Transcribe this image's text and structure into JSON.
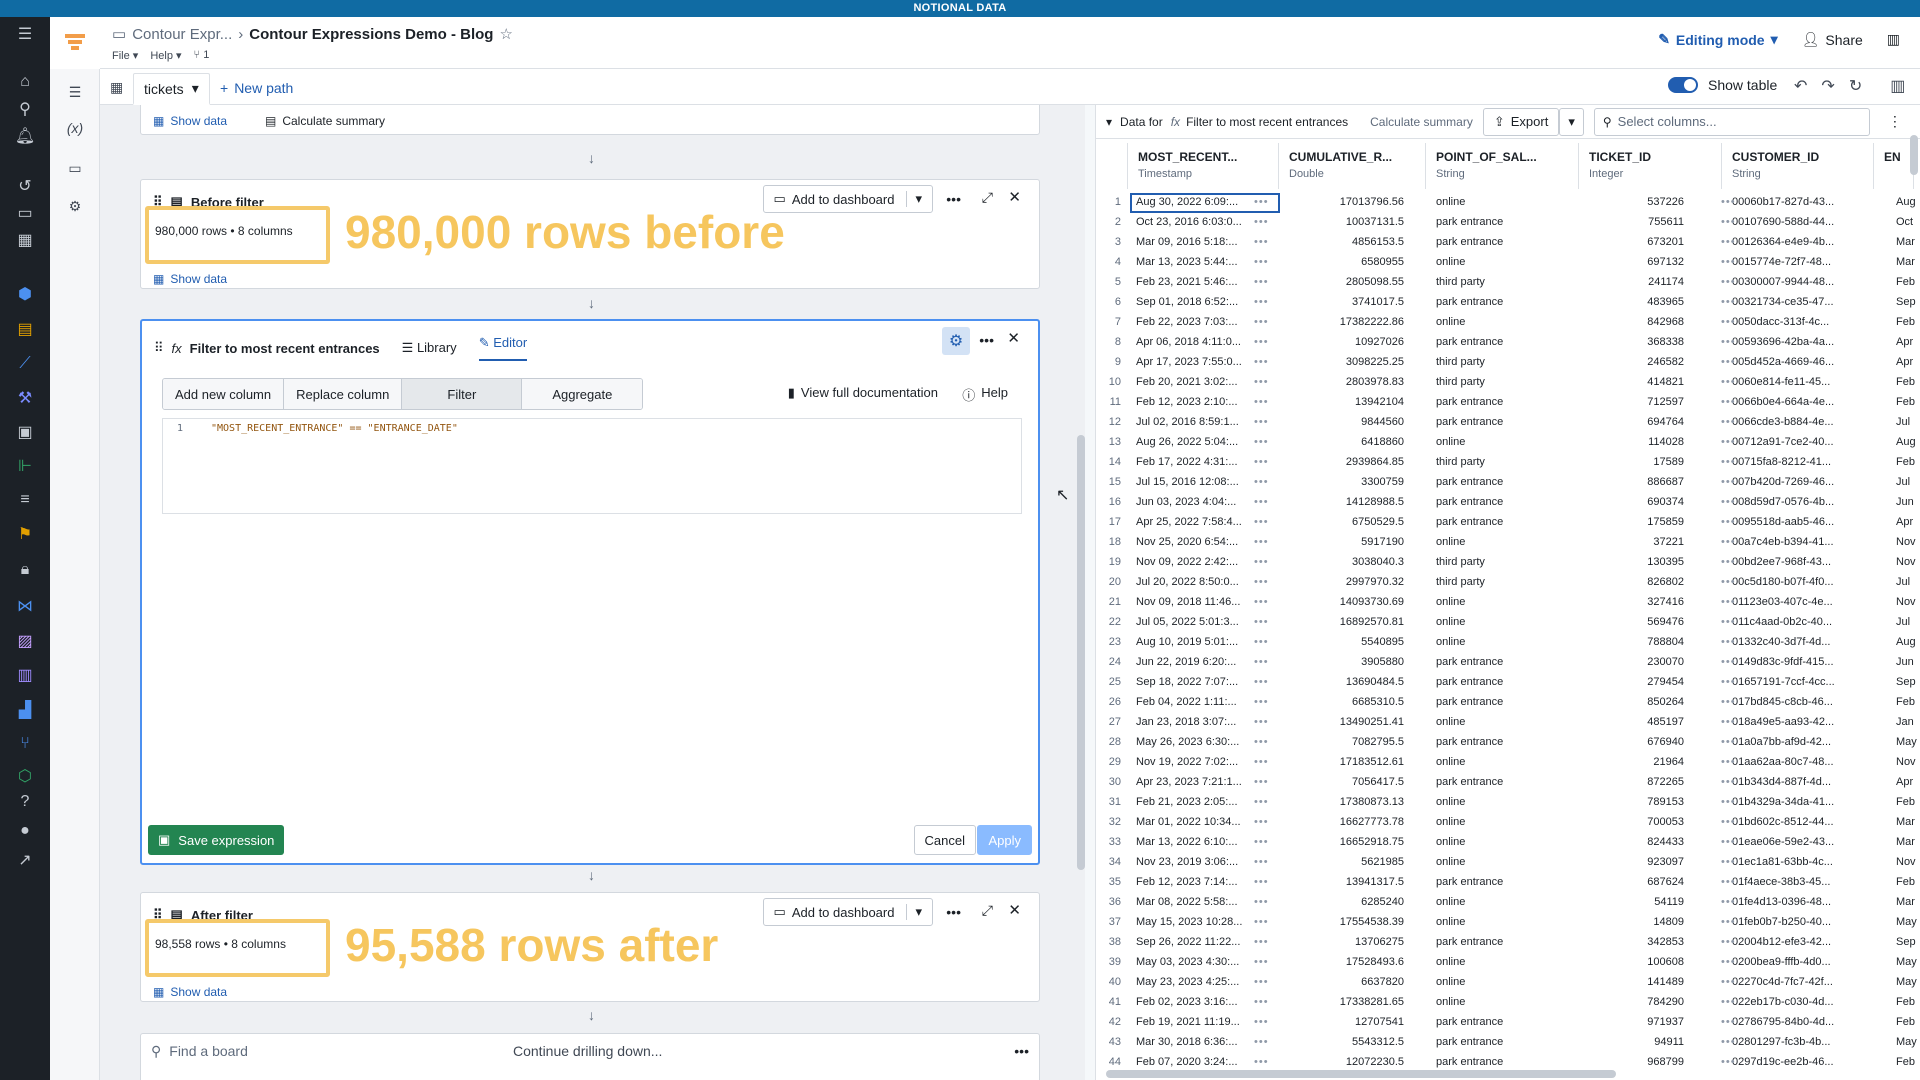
{
  "banner": "NOTIONAL DATA",
  "header": {
    "breadcrumb_parent": "Contour Expr...",
    "title": "Contour Expressions Demo - Blog",
    "menu_file": "File",
    "menu_help": "Help",
    "branch_count": "1",
    "editing_mode": "Editing mode",
    "share": "Share"
  },
  "tabs": {
    "active": "tickets",
    "new_path": "New path"
  },
  "board_top": {
    "show_data": "Show data",
    "calc_summary": "Calculate summary"
  },
  "before": {
    "title": "Before filter",
    "rows": "980,000 rows",
    "cols": "8 columns",
    "add_dash": "Add to dashboard",
    "show_data": "Show data",
    "annotation": "980,000 rows before"
  },
  "filter": {
    "title": "Filter to most recent entrances",
    "library": "Library",
    "editor": "Editor",
    "seg": [
      "Add new column",
      "Replace column",
      "Filter",
      "Aggregate"
    ],
    "docs": "View full documentation",
    "help": "Help",
    "line_no": "1",
    "code": "\"MOST_RECENT_ENTRANCE\" == \"ENTRANCE_DATE\"",
    "save": "Save expression",
    "cancel": "Cancel",
    "apply": "Apply"
  },
  "after": {
    "title": "After filter",
    "rows": "98,558 rows",
    "cols": "8 columns",
    "add_dash": "Add to dashboard",
    "show_data": "Show data",
    "annotation": "95,588 rows after"
  },
  "bottom": {
    "find": "Find a board",
    "continue": "Continue drilling down..."
  },
  "grid": {
    "show_table": "Show table",
    "data_for": "Data for",
    "board": "Filter to most recent entrances",
    "calc": "Calculate summary",
    "export": "Export",
    "select_placeholder": "Select columns...",
    "columns": [
      {
        "name": "MOST_RECENT...",
        "type": "Timestamp"
      },
      {
        "name": "CUMULATIVE_R...",
        "type": "Double"
      },
      {
        "name": "POINT_OF_SAL...",
        "type": "String"
      },
      {
        "name": "TICKET_ID",
        "type": "Integer"
      },
      {
        "name": "CUSTOMER_ID",
        "type": "String"
      },
      {
        "name": "EN",
        "type": ""
      }
    ],
    "rows": [
      [
        "1",
        "Aug 30, 2022 6:09:...",
        "17013796.56",
        "online",
        "537226",
        "00060b17-827d-43...",
        "Aug"
      ],
      [
        "2",
        "Oct 23, 2016 6:03:0...",
        "10037131.5",
        "park entrance",
        "755611",
        "00107690-588d-44...",
        "Oct"
      ],
      [
        "3",
        "Mar 09, 2016 5:18:...",
        "4856153.5",
        "park entrance",
        "673201",
        "00126364-e4e9-4b...",
        "Mar"
      ],
      [
        "4",
        "Mar 13, 2023 5:44:...",
        "6580955",
        "online",
        "697132",
        "0015774e-72f7-48...",
        "Mar"
      ],
      [
        "5",
        "Feb 23, 2021 5:46:...",
        "2805098.55",
        "third party",
        "241174",
        "00300007-9944-48...",
        "Feb"
      ],
      [
        "6",
        "Sep 01, 2018 6:52:...",
        "3741017.5",
        "park entrance",
        "483965",
        "00321734-ce35-47...",
        "Sep"
      ],
      [
        "7",
        "Feb 22, 2023 7:03:...",
        "17382222.86",
        "online",
        "842968",
        "0050dacc-313f-4c...",
        "Feb"
      ],
      [
        "8",
        "Apr 06, 2018 4:11:0...",
        "10927026",
        "park entrance",
        "368338",
        "00593696-42ba-4a...",
        "Apr"
      ],
      [
        "9",
        "Apr 17, 2023 7:55:0...",
        "3098225.25",
        "third party",
        "246582",
        "005d452a-4669-46...",
        "Apr"
      ],
      [
        "10",
        "Feb 20, 2021 3:02:...",
        "2803978.83",
        "third party",
        "414821",
        "0060e814-fe11-45...",
        "Feb"
      ],
      [
        "11",
        "Feb 12, 2023 2:10:...",
        "13942104",
        "park entrance",
        "712597",
        "0066b0e4-664a-4e...",
        "Feb"
      ],
      [
        "12",
        "Jul 02, 2016 8:59:1...",
        "9844560",
        "park entrance",
        "694764",
        "0066cde3-b884-4e...",
        "Jul"
      ],
      [
        "13",
        "Aug 26, 2022 5:04:...",
        "6418860",
        "online",
        "114028",
        "00712a91-7ce2-40...",
        "Aug"
      ],
      [
        "14",
        "Feb 17, 2022 4:31:...",
        "2939864.85",
        "third party",
        "17589",
        "00715fa8-8212-41...",
        "Feb"
      ],
      [
        "15",
        "Jul 15, 2016 12:08:...",
        "3300759",
        "park entrance",
        "886687",
        "007b420d-7269-46...",
        "Jul"
      ],
      [
        "16",
        "Jun 03, 2023 4:04:...",
        "14128988.5",
        "park entrance",
        "690374",
        "008d59d7-0576-4b...",
        "Jun"
      ],
      [
        "17",
        "Apr 25, 2022 7:58:4...",
        "6750529.5",
        "park entrance",
        "175859",
        "0095518d-aab5-46...",
        "Apr"
      ],
      [
        "18",
        "Nov 25, 2020 6:54:...",
        "5917190",
        "online",
        "37221",
        "00a7c4eb-b394-41...",
        "Nov"
      ],
      [
        "19",
        "Nov 09, 2022 2:42:...",
        "3038040.3",
        "third party",
        "130395",
        "00bd2ee7-968f-43...",
        "Nov"
      ],
      [
        "20",
        "Jul 20, 2022 8:50:0...",
        "2997970.32",
        "third party",
        "826802",
        "00c5d180-b07f-4f0...",
        "Jul"
      ],
      [
        "21",
        "Nov 09, 2018 11:46...",
        "14093730.69",
        "online",
        "327416",
        "01123e03-407c-4e...",
        "Nov"
      ],
      [
        "22",
        "Jul 05, 2022 5:01:3...",
        "16892570.81",
        "online",
        "569476",
        "011c4aad-0b2c-40...",
        "Jul"
      ],
      [
        "23",
        "Aug 10, 2019 5:01:...",
        "5540895",
        "online",
        "788804",
        "01332c40-3d7f-4d...",
        "Aug"
      ],
      [
        "24",
        "Jun 22, 2019 6:20:...",
        "3905880",
        "park entrance",
        "230070",
        "0149d83c-9fdf-415...",
        "Jun"
      ],
      [
        "25",
        "Sep 18, 2022 7:07:...",
        "13690484.5",
        "park entrance",
        "279454",
        "01657191-7ccf-4cc...",
        "Sep"
      ],
      [
        "26",
        "Feb 04, 2022 1:11:...",
        "6685310.5",
        "park entrance",
        "850264",
        "017bd845-c8cb-46...",
        "Feb"
      ],
      [
        "27",
        "Jan 23, 2018 3:07:...",
        "13490251.41",
        "online",
        "485197",
        "018a49e5-aa93-42...",
        "Jan"
      ],
      [
        "28",
        "May 26, 2023 6:30:...",
        "7082795.5",
        "park entrance",
        "676940",
        "01a0a7bb-af9d-42...",
        "May"
      ],
      [
        "29",
        "Nov 19, 2022 7:02:...",
        "17183512.61",
        "online",
        "21964",
        "01aa62aa-80c7-48...",
        "Nov"
      ],
      [
        "30",
        "Apr 23, 2023 7:21:1...",
        "7056417.5",
        "park entrance",
        "872265",
        "01b343d4-887f-4d...",
        "Apr"
      ],
      [
        "31",
        "Feb 21, 2023 2:05:...",
        "17380873.13",
        "online",
        "789153",
        "01b4329a-34da-41...",
        "Feb"
      ],
      [
        "32",
        "Mar 01, 2022 10:34...",
        "16627773.78",
        "online",
        "700053",
        "01bd602c-8512-44...",
        "Mar"
      ],
      [
        "33",
        "Mar 13, 2022 6:10:...",
        "16652918.75",
        "online",
        "824433",
        "01eae06e-59e2-43...",
        "Mar"
      ],
      [
        "34",
        "Nov 23, 2019 3:06:...",
        "5621985",
        "online",
        "923097",
        "01ec1a81-63bb-4c...",
        "Nov"
      ],
      [
        "35",
        "Feb 12, 2023 7:14:...",
        "13941317.5",
        "park entrance",
        "687624",
        "01f4aece-38b3-45...",
        "Feb"
      ],
      [
        "36",
        "Mar 08, 2022 5:58:...",
        "6285240",
        "online",
        "54119",
        "01fe4d13-0396-48...",
        "Mar"
      ],
      [
        "37",
        "May 15, 2023 10:28...",
        "17554538.39",
        "online",
        "14809",
        "01feb0b7-b250-40...",
        "May"
      ],
      [
        "38",
        "Sep 26, 2022 11:22...",
        "13706275",
        "park entrance",
        "342853",
        "02004b12-efe3-42...",
        "Sep"
      ],
      [
        "39",
        "May 03, 2023 4:30:...",
        "17528493.6",
        "online",
        "100608",
        "0200bea9-fffb-4d0...",
        "May"
      ],
      [
        "40",
        "May 23, 2023 4:25:...",
        "6637820",
        "online",
        "141489",
        "02270c4d-7fc7-42f...",
        "May"
      ],
      [
        "41",
        "Feb 02, 2023 3:16:...",
        "17338281.65",
        "online",
        "784290",
        "022eb17b-c030-4d...",
        "Feb"
      ],
      [
        "42",
        "Feb 19, 2021 11:19...",
        "12707541",
        "park entrance",
        "971937",
        "02786795-84b0-4d...",
        "Feb"
      ],
      [
        "43",
        "Mar 30, 2018 6:36:...",
        "5543312.5",
        "park entrance",
        "94911",
        "02801297-fc3b-4b...",
        "May"
      ],
      [
        "44",
        "Feb 07, 2020 3:24:...",
        "12072230.5",
        "park entrance",
        "968799",
        "0297d19c-ee2b-46...",
        "Feb"
      ]
    ]
  },
  "colors": {
    "accent": "#215db0",
    "banner": "#106ba3",
    "annotation": "#f6c65e",
    "save": "#238551"
  }
}
